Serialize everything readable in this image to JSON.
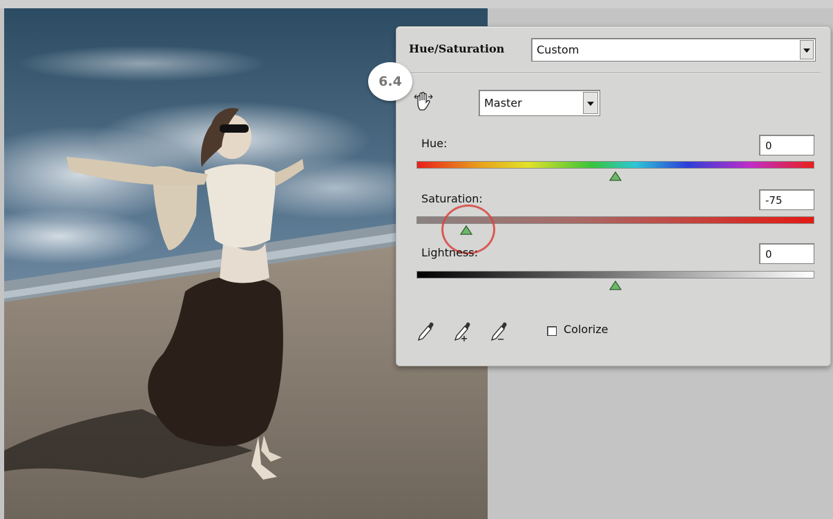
{
  "panel": {
    "title": "Hue/Saturation",
    "preset": {
      "value": "Custom"
    },
    "channel": {
      "value": "Master"
    },
    "step_badge": "6.4",
    "hue": {
      "label": "Hue:",
      "value": "0",
      "slider_position_percent": 50
    },
    "saturation": {
      "label": "Saturation:",
      "value": "-75",
      "slider_position_percent": 12.5
    },
    "lightness": {
      "label": "Lightness:",
      "value": "0",
      "slider_position_percent": 50
    },
    "colorize": {
      "label": "Colorize",
      "checked": false
    }
  },
  "icons": {
    "targeted_adjustment": "hand-scrubber-icon",
    "eyedroppers": [
      "eyedropper-icon",
      "eyedropper-add-icon",
      "eyedropper-subtract-icon"
    ],
    "dropdown_arrow": "chevron-down-icon"
  },
  "colors": {
    "panel_bg": "#d6d6d4",
    "slider_thumb": "#6db86a",
    "highlight_ring": "#d8443e",
    "workspace_bg": "#c4c4c4"
  }
}
